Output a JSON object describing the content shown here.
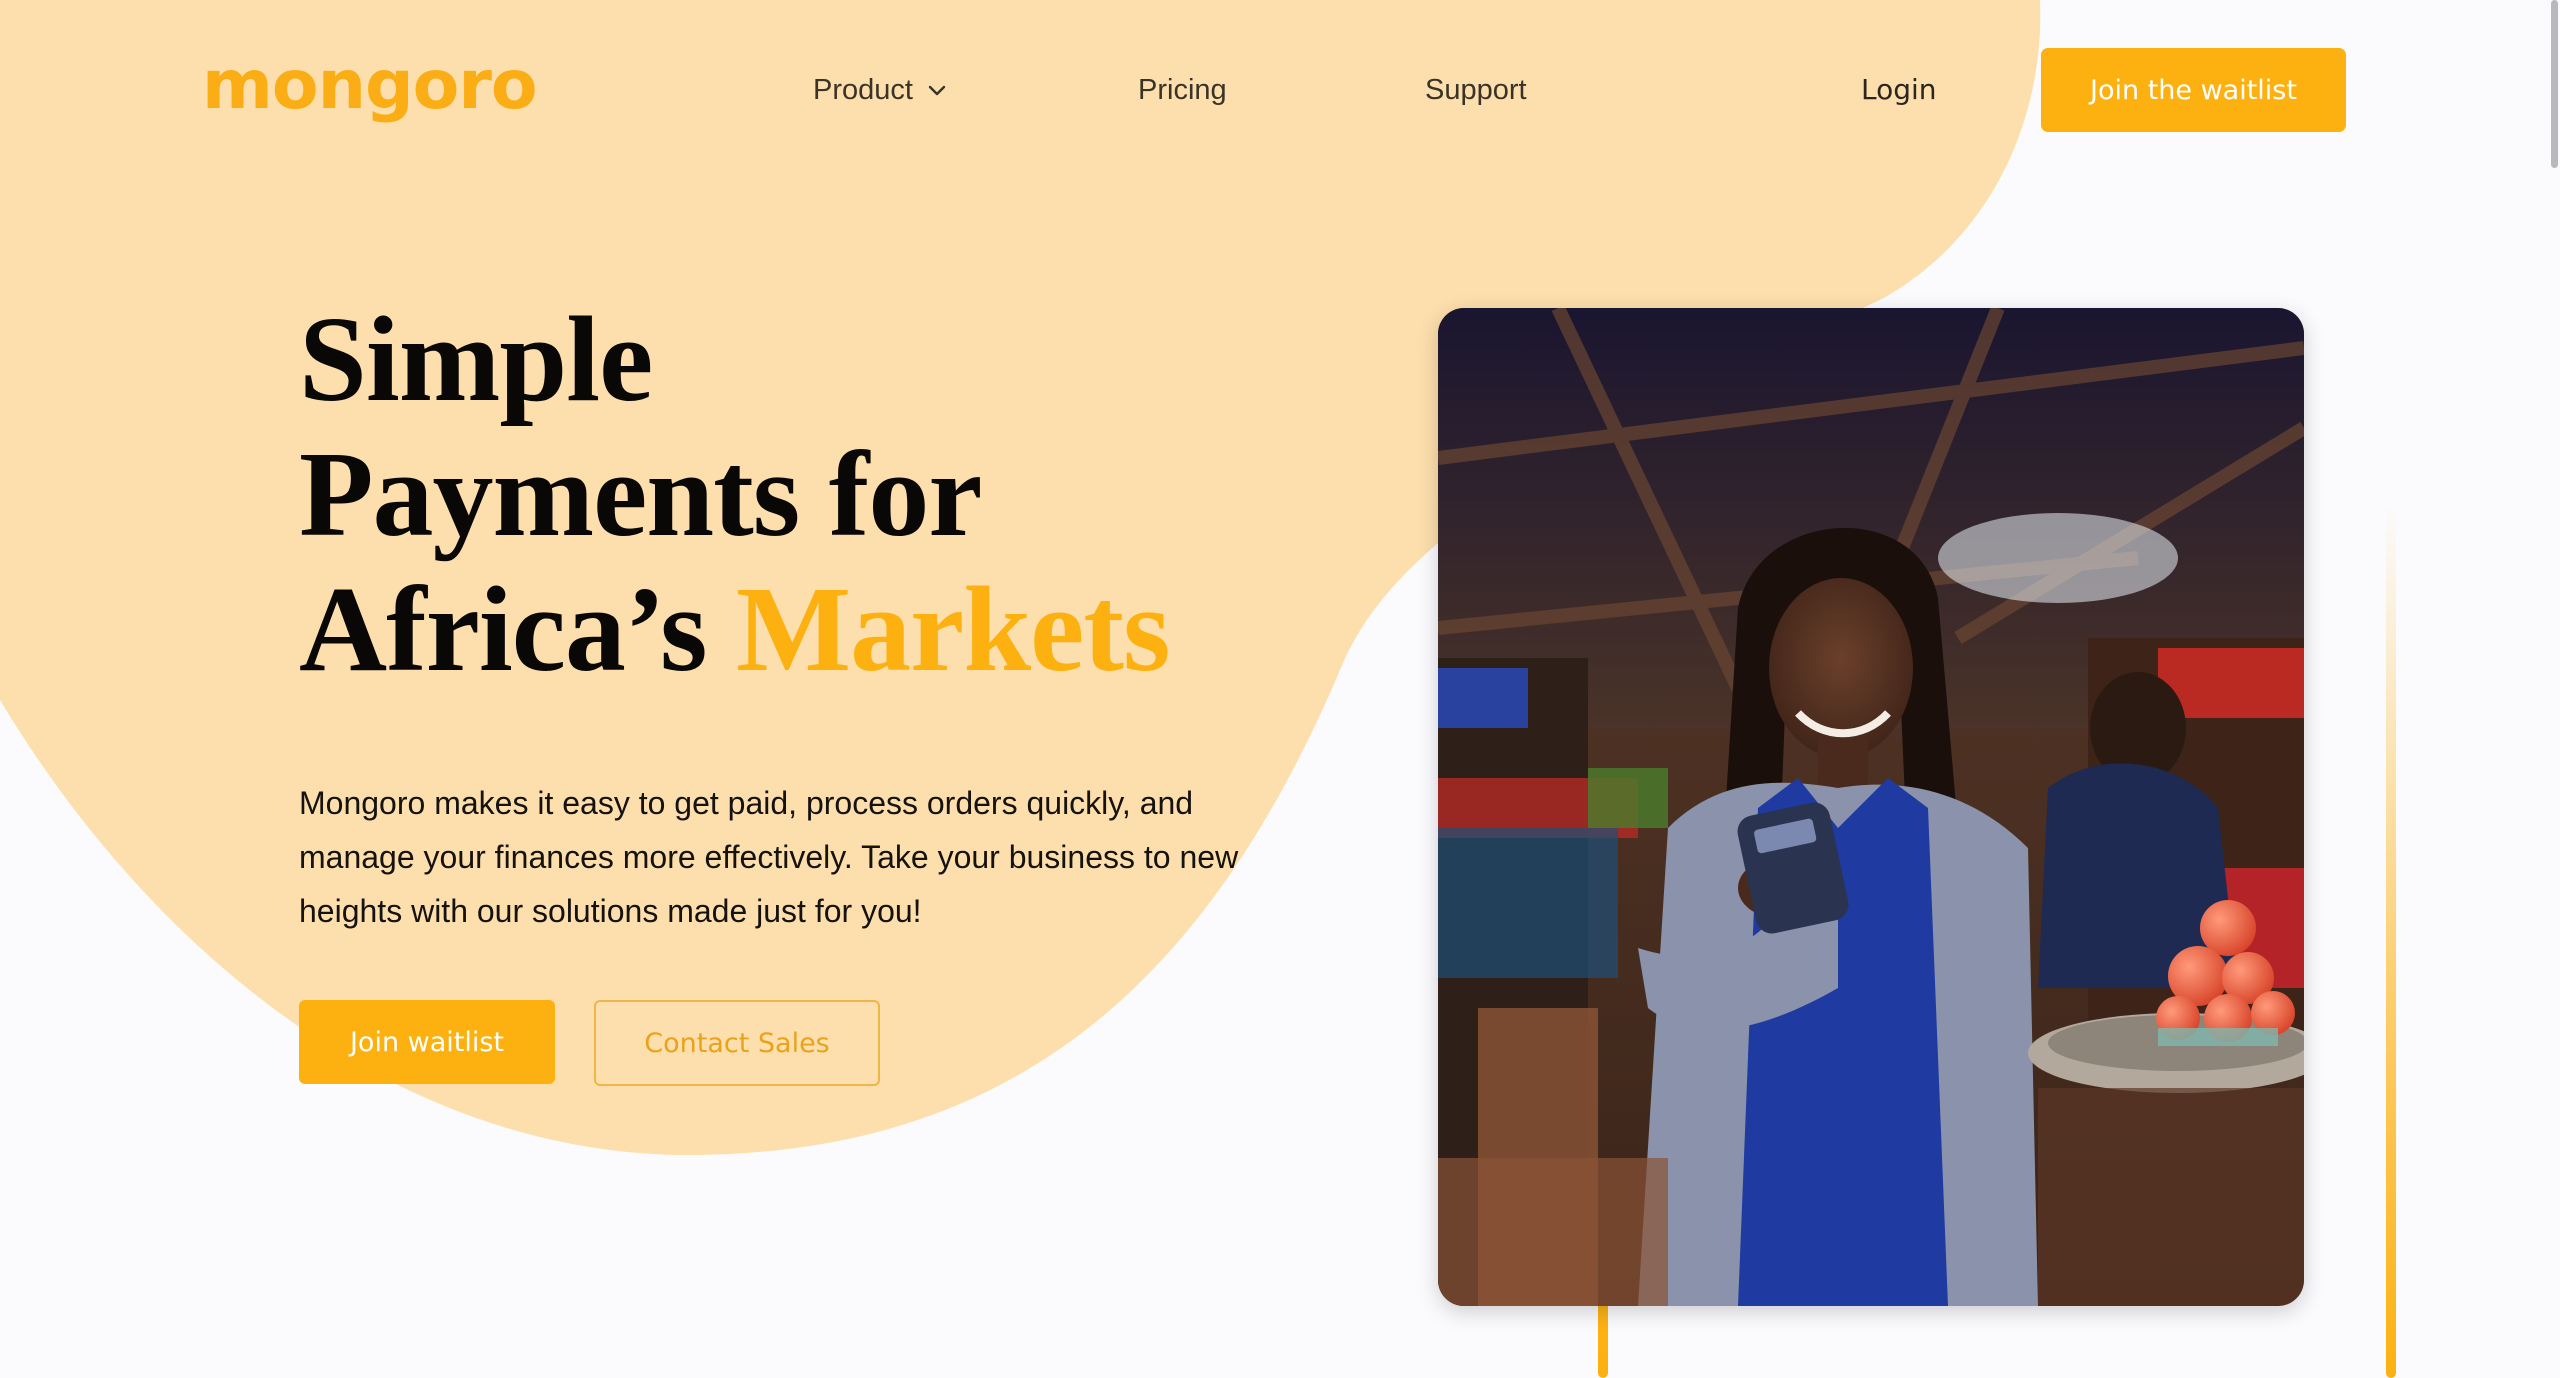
{
  "brand": {
    "name": "mongoro",
    "color": "#fbad16"
  },
  "nav": {
    "items": [
      {
        "label": "Product",
        "icon": "chevron-down-icon"
      },
      {
        "label": "Pricing"
      },
      {
        "label": "Support"
      }
    ],
    "login_label": "Login",
    "cta_label": "Join the waitlist"
  },
  "hero": {
    "headline_line1": "Simple",
    "headline_line2": "Payments for",
    "headline_line3_prefix": "Africa’s ",
    "headline_accent": "Markets",
    "description": "Mongoro makes it easy to get paid, process orders quickly, and manage your finances more effectively. Take your business to new heights with our solutions made just for you!",
    "primary_button": "Join waitlist",
    "secondary_button": "Contact Sales",
    "image_description": "market-vendor-holding-pos-terminal-photo"
  },
  "colors": {
    "accent": "#fdb111",
    "blob": "#fddfad",
    "background": "#fbfbfe"
  }
}
